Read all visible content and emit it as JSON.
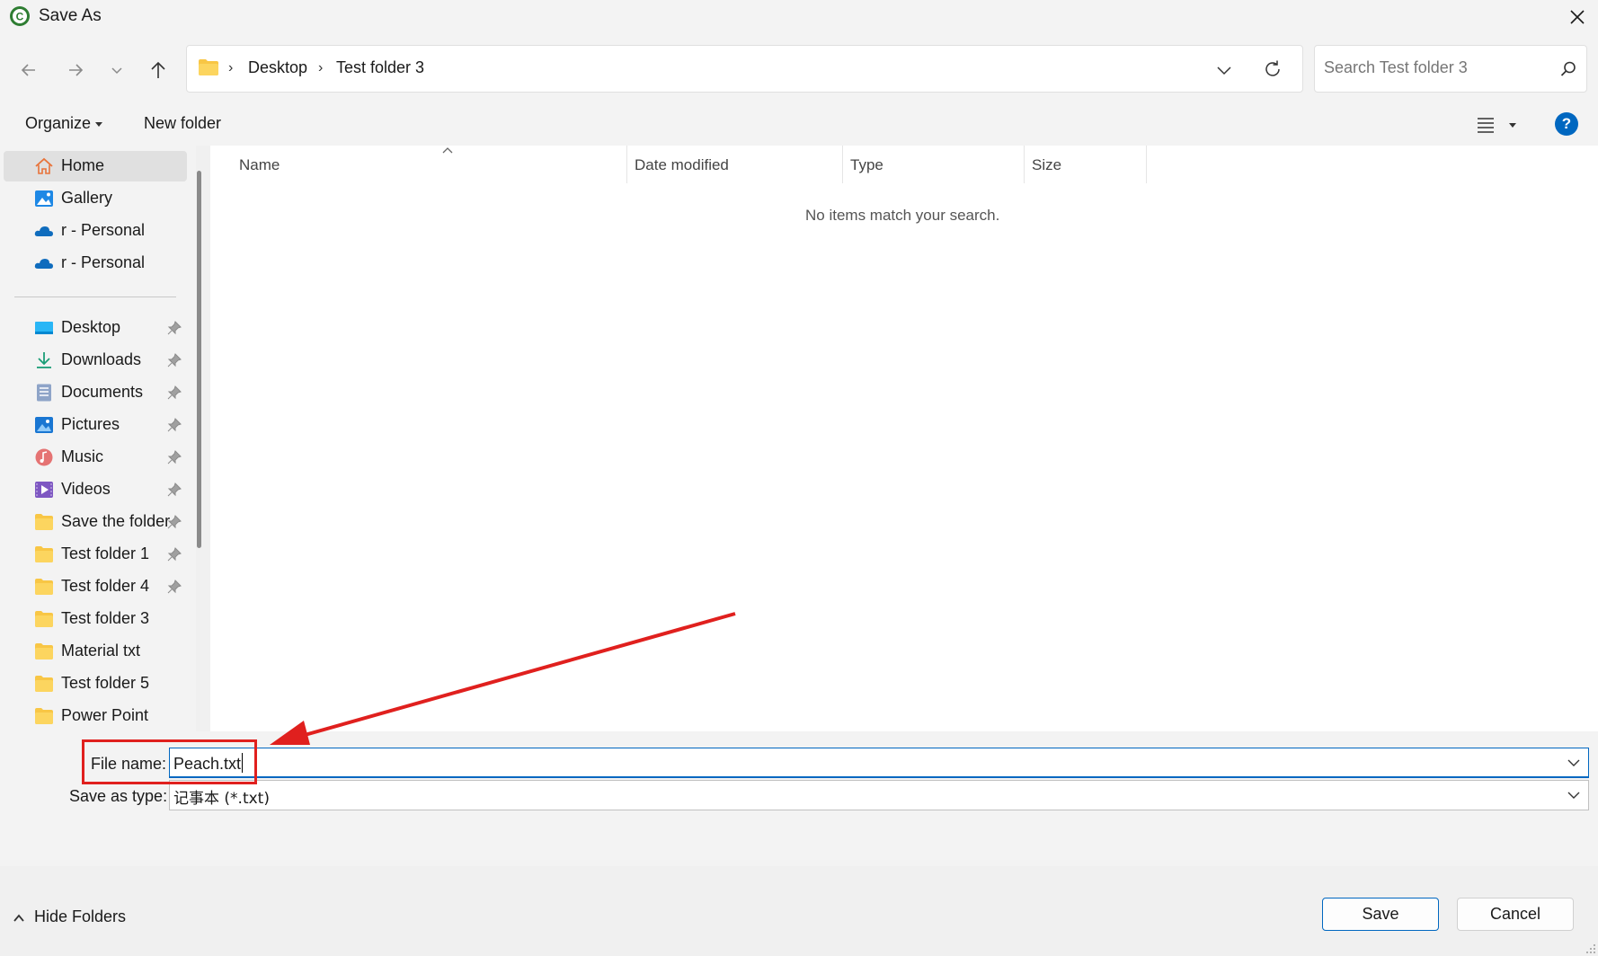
{
  "window": {
    "title": "Save As"
  },
  "nav": {
    "breadcrumbs": [
      "Desktop",
      "Test folder 3"
    ],
    "search_placeholder": "Search Test folder 3"
  },
  "toolbar": {
    "organize_label": "Organize",
    "new_folder_label": "New folder",
    "help_label": "?"
  },
  "sidebar": {
    "quick_items": [
      {
        "label": "Home",
        "icon": "home-icon",
        "selected": true
      },
      {
        "label": "Gallery",
        "icon": "gallery-icon"
      },
      {
        "label": "r - Personal",
        "icon": "onedrive-icon"
      },
      {
        "label": "r - Personal",
        "icon": "onedrive-icon"
      }
    ],
    "pinned_items": [
      {
        "label": "Desktop",
        "icon": "desktop-icon",
        "pinned": true
      },
      {
        "label": "Downloads",
        "icon": "download-icon",
        "pinned": true
      },
      {
        "label": "Documents",
        "icon": "document-icon",
        "pinned": true
      },
      {
        "label": "Pictures",
        "icon": "pictures-icon",
        "pinned": true
      },
      {
        "label": "Music",
        "icon": "music-icon",
        "pinned": true
      },
      {
        "label": "Videos",
        "icon": "videos-icon",
        "pinned": true
      },
      {
        "label": "Save the folder",
        "icon": "folder-icon",
        "pinned": true
      },
      {
        "label": "Test folder 1",
        "icon": "folder-icon",
        "pinned": true
      },
      {
        "label": "Test folder 4",
        "icon": "folder-icon",
        "pinned": true
      },
      {
        "label": "Test folder 3",
        "icon": "folder-icon",
        "pinned": false
      },
      {
        "label": "Material txt",
        "icon": "folder-icon",
        "pinned": false
      },
      {
        "label": "Test folder 5",
        "icon": "folder-icon",
        "pinned": false
      },
      {
        "label": "Power Point",
        "icon": "folder-icon",
        "pinned": false
      }
    ]
  },
  "file_list": {
    "columns": [
      "Name",
      "Date modified",
      "Type",
      "Size"
    ],
    "empty_message": "No items match your search."
  },
  "form": {
    "file_name_label": "File name:",
    "file_name_value": "Peach.txt",
    "save_type_label": "Save as type:",
    "save_type_value": "记事本 (*.txt)"
  },
  "footer": {
    "hide_folders_label": "Hide Folders",
    "save_label": "Save",
    "cancel_label": "Cancel"
  },
  "colors": {
    "accent": "#0067c0",
    "annotation": "#e0201e",
    "folder": "#f8c645"
  }
}
